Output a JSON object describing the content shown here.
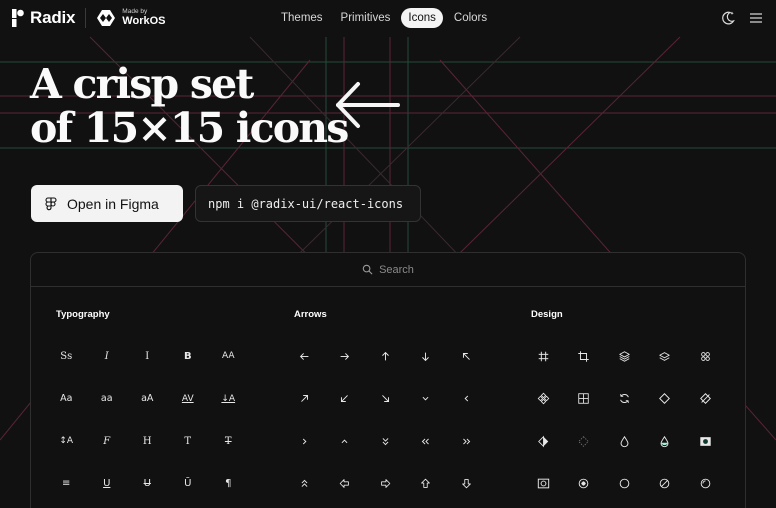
{
  "header": {
    "brand": "Radix",
    "made_by": "Made by",
    "partner": "WorkOS",
    "nav": [
      "Themes",
      "Primitives",
      "Icons",
      "Colors"
    ],
    "active_nav": "Icons"
  },
  "hero": {
    "title_line1": "A crisp set",
    "title_line2": "of 15×15 icons",
    "figma_button": "Open in Figma",
    "install_command": "npm i @radix-ui/react-icons"
  },
  "search": {
    "placeholder": "Search"
  },
  "categories": [
    {
      "name": "Typography",
      "icons": [
        "font-style-icon",
        "font-italic-icon",
        "italic-icon",
        "font-bold-icon",
        "letter-case-uppercase-icon",
        "letter-case-capitalize-icon",
        "letter-case-lowercase-icon",
        "letter-case-toggle-icon",
        "letter-spacing-icon",
        "align-baseline-icon",
        "font-size-icon",
        "font-family-icon",
        "font-roman-icon",
        "text-icon",
        "text-none-icon",
        "line-height-icon",
        "underline-icon",
        "strikethrough-icon",
        "overline-icon",
        "pilcrow-icon"
      ]
    },
    {
      "name": "Arrows",
      "icons": [
        "arrow-left-icon",
        "arrow-right-icon",
        "arrow-up-icon",
        "arrow-down-icon",
        "arrow-top-left-icon",
        "arrow-top-right-icon",
        "arrow-bottom-left-icon",
        "arrow-bottom-right-icon",
        "chevron-down-icon",
        "chevron-left-icon",
        "chevron-right-icon",
        "chevron-up-icon",
        "double-arrow-down-icon",
        "double-arrow-left-icon",
        "double-arrow-right-icon",
        "double-arrow-up-icon",
        "thick-arrow-left-icon",
        "thick-arrow-right-icon",
        "thick-arrow-up-icon",
        "thick-arrow-down-icon"
      ]
    },
    {
      "name": "Design",
      "icons": [
        "frame-icon",
        "crop-icon",
        "layers-icon",
        "stack-icon",
        "tokens-icon",
        "component-1-icon",
        "table-icon",
        "update-icon",
        "component-2-icon",
        "component-none-icon",
        "mix-icon",
        "transparency-grid-icon",
        "opacity-icon",
        "drop-icon",
        "mask-on-icon",
        "mask-off-icon",
        "shadow-icon",
        "circle-icon",
        "shadow-none-icon",
        "half-icon"
      ]
    }
  ],
  "typography_glyphs": [
    "Ss",
    "I",
    "I",
    "B",
    "AA",
    "Aa",
    "aa",
    "aA",
    "AV",
    "↓A",
    "↕A",
    "F",
    "H",
    "T",
    "T",
    "≡",
    "U",
    "U",
    "Ū",
    "¶"
  ],
  "colors": {
    "background": "#111111",
    "guide_green": "#1f4a3a",
    "guide_red": "#5c2a3c",
    "accent_dot": "#9ff0d6"
  }
}
